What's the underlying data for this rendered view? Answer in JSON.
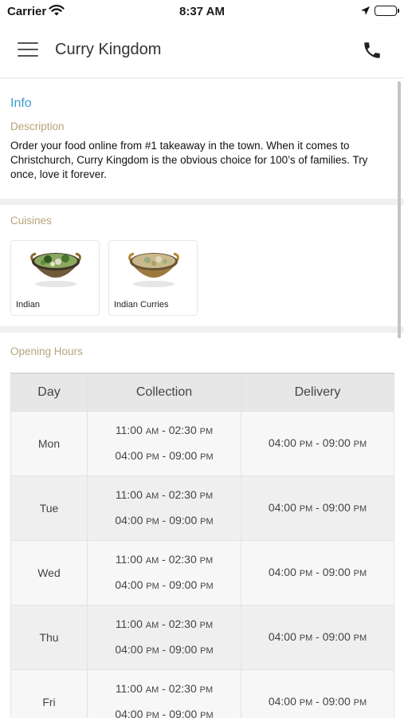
{
  "status_bar": {
    "carrier": "Carrier",
    "time": "8:37 AM"
  },
  "app_bar": {
    "title": "Curry Kingdom"
  },
  "info": {
    "title": "Info",
    "description_label": "Description",
    "description": "Order your food online from #1 takeaway in the town. When it comes to Christchurch, Curry Kingdom is the obvious choice for 100’s of families. Try once, love it forever."
  },
  "cuisines": {
    "label": "Cuisines",
    "items": [
      {
        "name": "Indian"
      },
      {
        "name": "Indian Curries"
      }
    ]
  },
  "opening_hours": {
    "label": "Opening Hours",
    "columns": [
      "Day",
      "Collection",
      "Delivery"
    ],
    "rows": [
      {
        "day": "Mon",
        "collection": [
          {
            "start": "11:00",
            "start_ampm": "AM",
            "end": "02:30",
            "end_ampm": "PM"
          },
          {
            "start": "04:00",
            "start_ampm": "PM",
            "end": "09:00",
            "end_ampm": "PM"
          }
        ],
        "delivery": [
          {
            "start": "04:00",
            "start_ampm": "PM",
            "end": "09:00",
            "end_ampm": "PM"
          }
        ]
      },
      {
        "day": "Tue",
        "collection": [
          {
            "start": "11:00",
            "start_ampm": "AM",
            "end": "02:30",
            "end_ampm": "PM"
          },
          {
            "start": "04:00",
            "start_ampm": "PM",
            "end": "09:00",
            "end_ampm": "PM"
          }
        ],
        "delivery": [
          {
            "start": "04:00",
            "start_ampm": "PM",
            "end": "09:00",
            "end_ampm": "PM"
          }
        ]
      },
      {
        "day": "Wed",
        "collection": [
          {
            "start": "11:00",
            "start_ampm": "AM",
            "end": "02:30",
            "end_ampm": "PM"
          },
          {
            "start": "04:00",
            "start_ampm": "PM",
            "end": "09:00",
            "end_ampm": "PM"
          }
        ],
        "delivery": [
          {
            "start": "04:00",
            "start_ampm": "PM",
            "end": "09:00",
            "end_ampm": "PM"
          }
        ]
      },
      {
        "day": "Thu",
        "collection": [
          {
            "start": "11:00",
            "start_ampm": "AM",
            "end": "02:30",
            "end_ampm": "PM"
          },
          {
            "start": "04:00",
            "start_ampm": "PM",
            "end": "09:00",
            "end_ampm": "PM"
          }
        ],
        "delivery": [
          {
            "start": "04:00",
            "start_ampm": "PM",
            "end": "09:00",
            "end_ampm": "PM"
          }
        ]
      },
      {
        "day": "Fri",
        "collection": [
          {
            "start": "11:00",
            "start_ampm": "AM",
            "end": "02:30",
            "end_ampm": "PM"
          },
          {
            "start": "04:00",
            "start_ampm": "PM",
            "end": "09:00",
            "end_ampm": "PM"
          }
        ],
        "delivery": [
          {
            "start": "04:00",
            "start_ampm": "PM",
            "end": "09:00",
            "end_ampm": "PM"
          }
        ]
      }
    ]
  },
  "icons": {
    "menu": "hamburger-menu-icon",
    "phone": "phone-icon",
    "wifi": "wifi-icon",
    "location": "location-arrow-icon",
    "battery": "battery-icon"
  },
  "colors": {
    "info_title": "#3c9ad0",
    "section_label": "#b8a37a",
    "table_header_bg": "#e7e7e7",
    "page_bg": "#f0f0f0"
  }
}
